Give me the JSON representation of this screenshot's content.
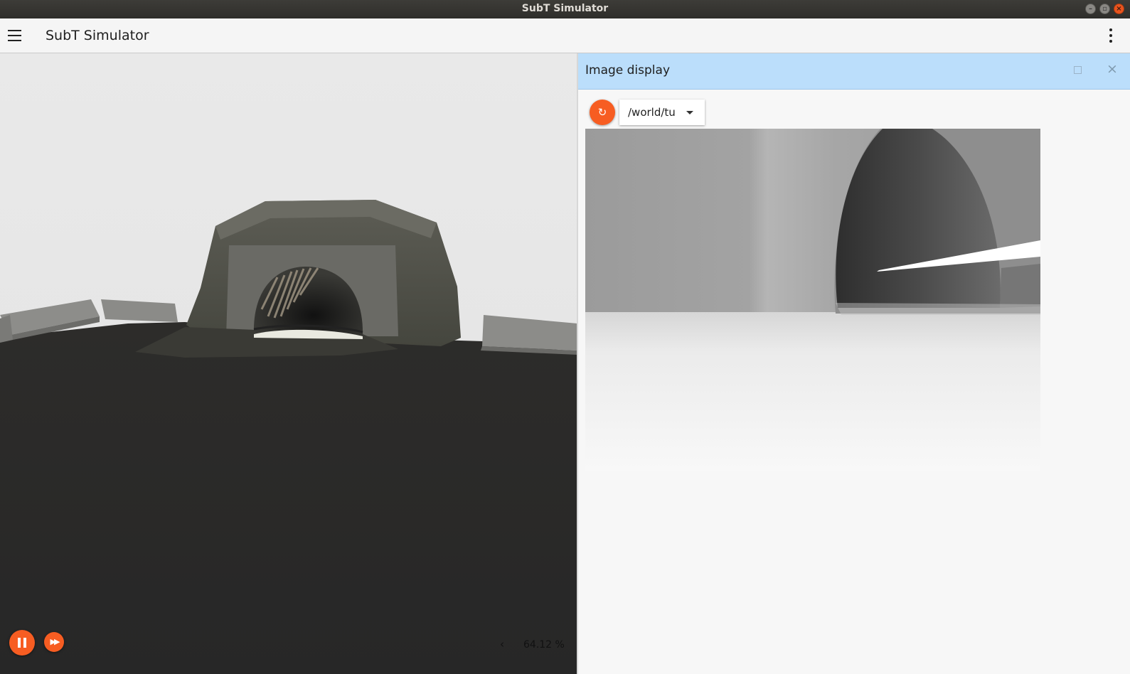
{
  "window": {
    "title": "SubT Simulator"
  },
  "appbar": {
    "title": "SubT Simulator",
    "menu_icon": "hamburger-menu-icon",
    "overflow_icon": "more-vert-icon"
  },
  "viewport": {
    "real_time_factor": "64.12 %",
    "controls": {
      "pause_icon": "pause-icon",
      "step_icon": "fast-forward-icon",
      "accent_color": "#f75d22"
    }
  },
  "image_display": {
    "title": "Image display",
    "header_color": "#bbdefb",
    "topic": "/world/tu",
    "refresh_icon": "refresh-icon",
    "maximize_icon": "maximize-icon",
    "close_icon": "close-icon"
  }
}
